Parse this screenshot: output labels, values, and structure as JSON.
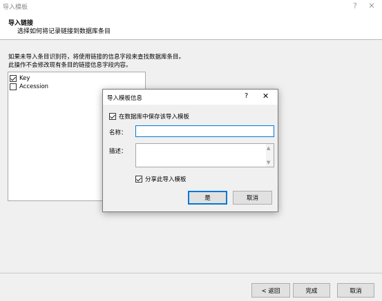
{
  "window": {
    "title": "导入模板",
    "help_glyph": "?",
    "close_glyph": "✕"
  },
  "header": {
    "title": "导入链接",
    "subtitle": "选择如何将记录链接到数据库条目"
  },
  "info": {
    "line1": "如果未导入条目识别符，将使用链接的信息字段来查找数据库条目。",
    "line2": "此操作不会修改现有条目的链接信息字段内容。"
  },
  "fields_list": {
    "items": [
      {
        "label": "Key",
        "checked": true
      },
      {
        "label": "Accession",
        "checked": false
      }
    ]
  },
  "dialog": {
    "title": "导入模板信息",
    "help_glyph": "?",
    "close_glyph": "✕",
    "save_checkbox_label": "在数据库中保存该导入模板",
    "save_checked": true,
    "name_label": "名称：",
    "name_value": "",
    "description_label": "描述：",
    "description_value": "",
    "share_checkbox_label": "分享此导入模板",
    "share_checked": true,
    "ok_label": "是",
    "cancel_label": "取消"
  },
  "footer": {
    "back_label": "< 返回",
    "finish_label": "完成",
    "cancel_label": "取消"
  },
  "colors": {
    "accent": "#0078d7",
    "background": "#f0f0f0"
  }
}
